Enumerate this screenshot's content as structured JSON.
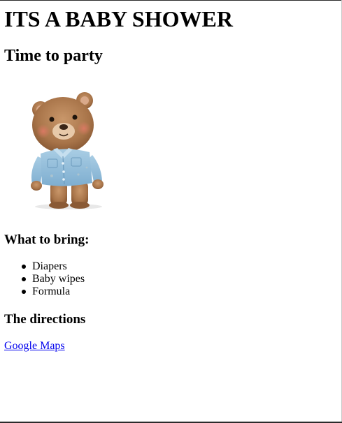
{
  "page": {
    "title": "ITS A BABY SHOWER",
    "subtitle": "Time to party"
  },
  "illustration": {
    "icon": "teddy-bear-in-denim-shirt"
  },
  "bring_section": {
    "heading": "What to bring:",
    "items": [
      "Diapers",
      "Baby wipes",
      "Formula"
    ]
  },
  "directions_section": {
    "heading": "The directions",
    "link_label": "Google Maps"
  },
  "colors": {
    "link": "#0000ee",
    "text": "#000000",
    "background": "#ffffff"
  }
}
